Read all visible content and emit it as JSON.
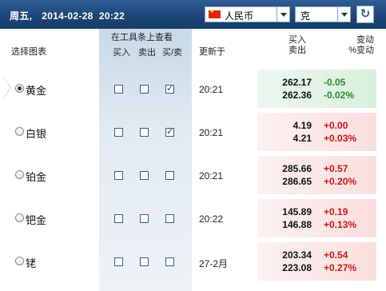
{
  "header": {
    "weekday": "周五,",
    "date": "2014-02-28",
    "time": "20:22",
    "currency": "人民币",
    "unit": "克",
    "refresh_icon": "refresh-icon"
  },
  "columns": {
    "select": "选择图表",
    "toolbar": "在工具条上查看",
    "buy": "买入",
    "sell": "卖出",
    "buysell": "买/卖",
    "updated": "更新于",
    "price_top": "买入",
    "price_bottom": "卖出",
    "change_top": "变动",
    "change_bottom": "%变动"
  },
  "rows": [
    {
      "name": "黄金",
      "selected": true,
      "buy": false,
      "sell": false,
      "buysell": true,
      "time": "20:21",
      "bid": "262.17",
      "ask": "262.36",
      "chg": "-0.05",
      "pct": "-0.02%",
      "trend": "down"
    },
    {
      "name": "白银",
      "selected": false,
      "buy": false,
      "sell": false,
      "buysell": true,
      "time": "20:21",
      "bid": "4.19",
      "ask": "4.21",
      "chg": "+0.00",
      "pct": "+0.03%",
      "trend": "up"
    },
    {
      "name": "铂金",
      "selected": false,
      "buy": false,
      "sell": false,
      "buysell": false,
      "time": "20:21",
      "bid": "285.66",
      "ask": "286.65",
      "chg": "+0.57",
      "pct": "+0.20%",
      "trend": "up"
    },
    {
      "name": "钯金",
      "selected": false,
      "buy": false,
      "sell": false,
      "buysell": false,
      "time": "20:22",
      "bid": "145.89",
      "ask": "146.88",
      "chg": "+0.19",
      "pct": "+0.13%",
      "trend": "up"
    },
    {
      "name": "铑",
      "selected": false,
      "buy": false,
      "sell": false,
      "buysell": false,
      "time": "27-2月",
      "bid": "203.34",
      "ask": "223.08",
      "chg": "+0.54",
      "pct": "+0.27%",
      "trend": "up"
    }
  ],
  "colors": {
    "header_bg": "#1c4676",
    "up": "#d01414",
    "down": "#238a2c",
    "toolbar_column_bg": "#dce7f0"
  }
}
